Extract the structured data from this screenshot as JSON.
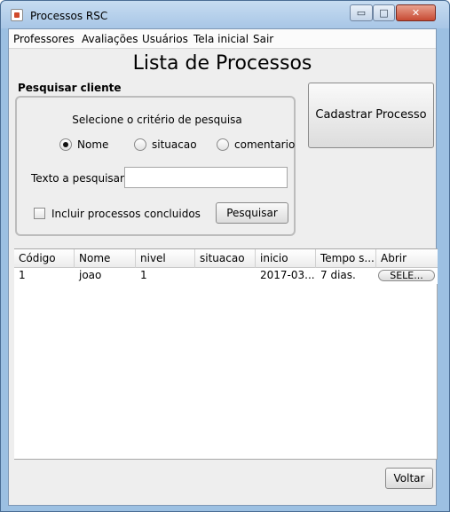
{
  "window": {
    "title": "Processos RSC",
    "controls": {
      "minimize": "▭",
      "maximize": "□",
      "close": "✕"
    }
  },
  "menu": [
    "Professores",
    "Avaliações",
    "Usuários",
    "Tela inicial",
    "Sair"
  ],
  "page_title": "Lista de Processos",
  "search": {
    "section_label": "Pesquisar cliente",
    "criteria_label": "Selecione o critério de pesquisa",
    "options": [
      "Nome",
      "situacao",
      "comentario"
    ],
    "selected": "Nome",
    "text_label": "Texto a pesquisar",
    "text_value": "",
    "include_label": "Incluir processos concluidos",
    "include_checked": false,
    "search_button": "Pesquisar"
  },
  "register_button": "Cadastrar Processo",
  "table": {
    "columns": [
      "Código",
      "Nome",
      "nivel",
      "situacao",
      "inicio",
      "Tempo s...",
      "Abrir"
    ],
    "rows": [
      {
        "codigo": "1",
        "nome": "joao",
        "nivel": "1",
        "situacao": "",
        "inicio": "2017-03...",
        "tempo": "7 dias.",
        "abrir": "SELE..."
      }
    ]
  },
  "back_button": "Voltar"
}
